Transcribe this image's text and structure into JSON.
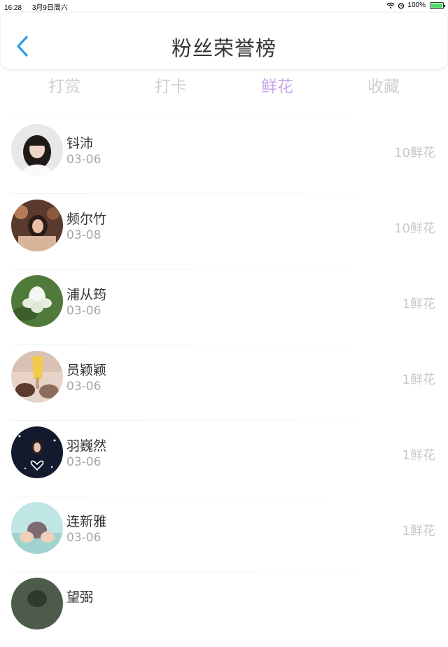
{
  "status_bar": {
    "time": "16:28",
    "date": "3月9日周六",
    "battery": "100%",
    "icons": [
      "wifi-icon",
      "alarm-icon",
      "battery-icon"
    ]
  },
  "nav": {
    "title": "粉丝荣誉榜",
    "back_icon": "chevron-left-icon"
  },
  "colors": {
    "accent": "#c5a6e8",
    "back_arrow": "#2f9be3",
    "inactive_tab": "#cfcfcf",
    "muted_text": "#a8a8a8"
  },
  "tabs": [
    {
      "label": "打赏",
      "active": false
    },
    {
      "label": "打卡",
      "active": false
    },
    {
      "label": "鲜花",
      "active": true
    },
    {
      "label": "收藏",
      "active": false
    }
  ],
  "fans": [
    {
      "name": "钭沛",
      "date": "03-06",
      "count": "10鲜花"
    },
    {
      "name": "频尔竹",
      "date": "03-08",
      "count": "10鲜花"
    },
    {
      "name": "浦从筠",
      "date": "03-06",
      "count": "1鲜花"
    },
    {
      "name": "员颖颖",
      "date": "03-06",
      "count": "1鲜花"
    },
    {
      "name": "羽巍然",
      "date": "03-06",
      "count": "1鲜花"
    },
    {
      "name": "连新雅",
      "date": "03-06",
      "count": "1鲜花"
    },
    {
      "name": "望弼",
      "date": "",
      "count": ""
    }
  ]
}
